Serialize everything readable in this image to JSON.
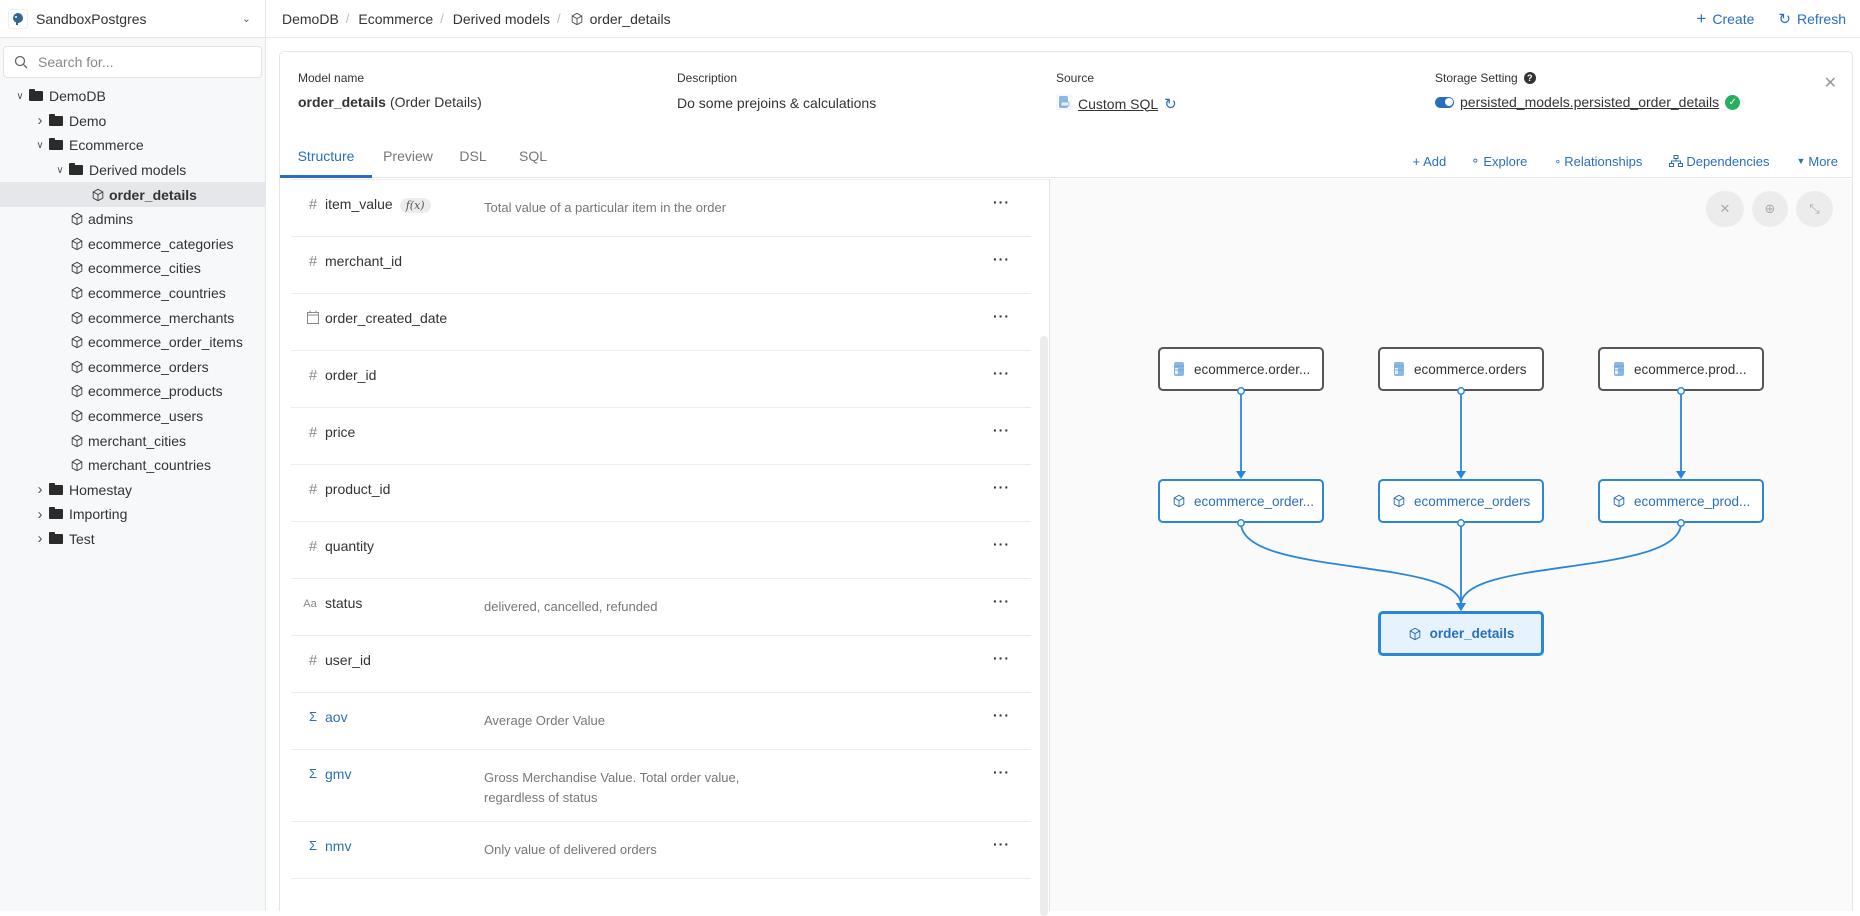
{
  "sidebar": {
    "workspace": "SandboxPostgres",
    "search_placeholder": "Search for...",
    "tree": [
      {
        "label": "DemoDB",
        "type": "folder",
        "depth": 0,
        "expanded": true
      },
      {
        "label": "Demo",
        "type": "folder",
        "depth": 1,
        "expanded": false
      },
      {
        "label": "Ecommerce",
        "type": "folder",
        "depth": 1,
        "expanded": true
      },
      {
        "label": "Derived models",
        "type": "folder",
        "depth": 2,
        "expanded": true
      },
      {
        "label": "order_details",
        "type": "model",
        "depth": 3,
        "selected": true
      },
      {
        "label": "admins",
        "type": "model",
        "depth": 2
      },
      {
        "label": "ecommerce_categories",
        "type": "model",
        "depth": 2
      },
      {
        "label": "ecommerce_cities",
        "type": "model",
        "depth": 2
      },
      {
        "label": "ecommerce_countries",
        "type": "model",
        "depth": 2
      },
      {
        "label": "ecommerce_merchants",
        "type": "model",
        "depth": 2
      },
      {
        "label": "ecommerce_order_items",
        "type": "model",
        "depth": 2
      },
      {
        "label": "ecommerce_orders",
        "type": "model",
        "depth": 2
      },
      {
        "label": "ecommerce_products",
        "type": "model",
        "depth": 2
      },
      {
        "label": "ecommerce_users",
        "type": "model",
        "depth": 2
      },
      {
        "label": "merchant_cities",
        "type": "model",
        "depth": 2
      },
      {
        "label": "merchant_countries",
        "type": "model",
        "depth": 2
      },
      {
        "label": "Homestay",
        "type": "folder",
        "depth": 1,
        "expanded": false
      },
      {
        "label": "Importing",
        "type": "folder",
        "depth": 1,
        "expanded": false
      },
      {
        "label": "Test",
        "type": "folder",
        "depth": 1,
        "expanded": false
      }
    ]
  },
  "breadcrumb": [
    "DemoDB",
    "Ecommerce",
    "Derived models",
    "order_details"
  ],
  "top_actions": {
    "create": "Create",
    "refresh": "Refresh"
  },
  "model": {
    "name_label": "Model name",
    "name": "order_details",
    "display_name": "(Order Details)",
    "description_label": "Description",
    "description": "Do some prejoins & calculations",
    "source_label": "Source",
    "source": "Custom SQL",
    "storage_label": "Storage Setting",
    "storage_enabled": true,
    "storage_table": "persisted_models.persisted_order_details",
    "storage_status": "ok"
  },
  "tabs": [
    "Structure",
    "Preview",
    "DSL",
    "SQL"
  ],
  "active_tab": "Structure",
  "panel_actions": [
    "Add",
    "Explore",
    "Relationships",
    "Dependencies",
    "More"
  ],
  "fields": [
    {
      "name": "item_value",
      "type": "number",
      "calculated": true,
      "fx_label": "f(x)",
      "description": "Total value of a particular item in the order"
    },
    {
      "name": "merchant_id",
      "type": "number",
      "description": ""
    },
    {
      "name": "order_created_date",
      "type": "date",
      "description": ""
    },
    {
      "name": "order_id",
      "type": "number",
      "description": ""
    },
    {
      "name": "price",
      "type": "number",
      "description": ""
    },
    {
      "name": "product_id",
      "type": "number",
      "description": ""
    },
    {
      "name": "quantity",
      "type": "number",
      "description": ""
    },
    {
      "name": "status",
      "type": "text",
      "description": "delivered, cancelled, refunded"
    },
    {
      "name": "user_id",
      "type": "number",
      "description": ""
    },
    {
      "name": "aov",
      "type": "metric",
      "description": "Average Order Value"
    },
    {
      "name": "gmv",
      "type": "metric",
      "description": "Gross Merchandise Value. Total order value, regardless of status"
    },
    {
      "name": "nmv",
      "type": "metric",
      "description": "Only value of delivered orders"
    }
  ],
  "more_glyph": "···",
  "graph": {
    "controls": [
      "close",
      "recenter",
      "expand"
    ],
    "nodes": [
      {
        "id": "s1",
        "label": "ecommerce.order...",
        "kind": "table",
        "col": 0,
        "row": 0
      },
      {
        "id": "s2",
        "label": "ecommerce.orders",
        "kind": "table",
        "col": 1,
        "row": 0
      },
      {
        "id": "s3",
        "label": "ecommerce.prod...",
        "kind": "table",
        "col": 2,
        "row": 0
      },
      {
        "id": "m1",
        "label": "ecommerce_order...",
        "kind": "model",
        "col": 0,
        "row": 1
      },
      {
        "id": "m2",
        "label": "ecommerce_orders",
        "kind": "model",
        "col": 1,
        "row": 1
      },
      {
        "id": "m3",
        "label": "ecommerce_prod...",
        "kind": "model",
        "col": 2,
        "row": 1
      },
      {
        "id": "t",
        "label": "order_details",
        "kind": "target",
        "col": 1,
        "row": 2
      }
    ],
    "edges": [
      [
        "s1",
        "m1"
      ],
      [
        "s2",
        "m2"
      ],
      [
        "s3",
        "m3"
      ],
      [
        "m1",
        "t"
      ],
      [
        "m2",
        "t"
      ],
      [
        "m3",
        "t"
      ]
    ]
  },
  "colors": {
    "accent": "#2a6fbd",
    "edge": "#2a87d8",
    "success": "#27ae60"
  }
}
